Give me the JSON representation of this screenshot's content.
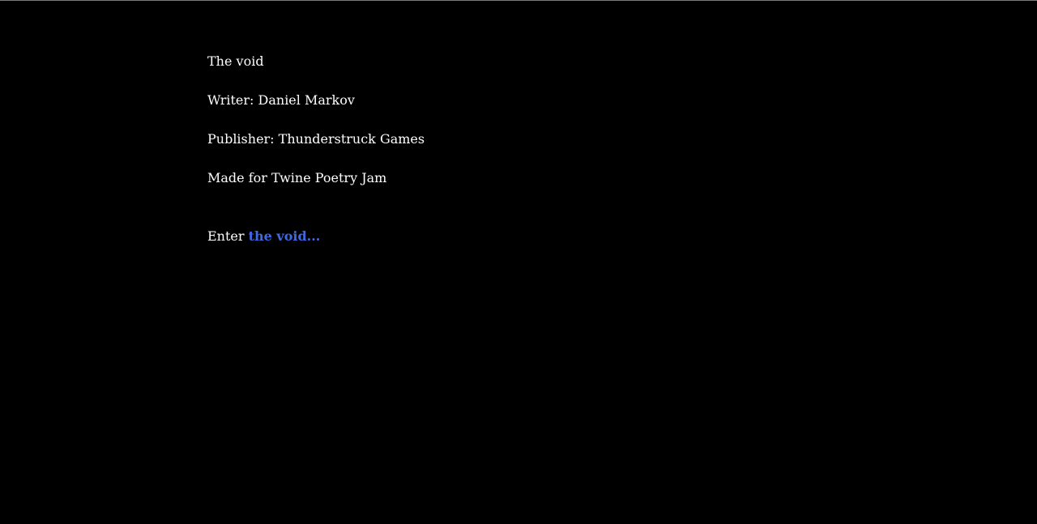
{
  "passage": {
    "title": "The void",
    "writer": "Writer: Daniel Markov",
    "publisher": "Publisher: Thunderstruck Games",
    "jam": "Made for Twine Poetry Jam",
    "enter_prefix": "Enter",
    "enter_link": "the void..."
  },
  "colors": {
    "background": "#000000",
    "text": "#ffffff",
    "link": "#4169e1"
  }
}
